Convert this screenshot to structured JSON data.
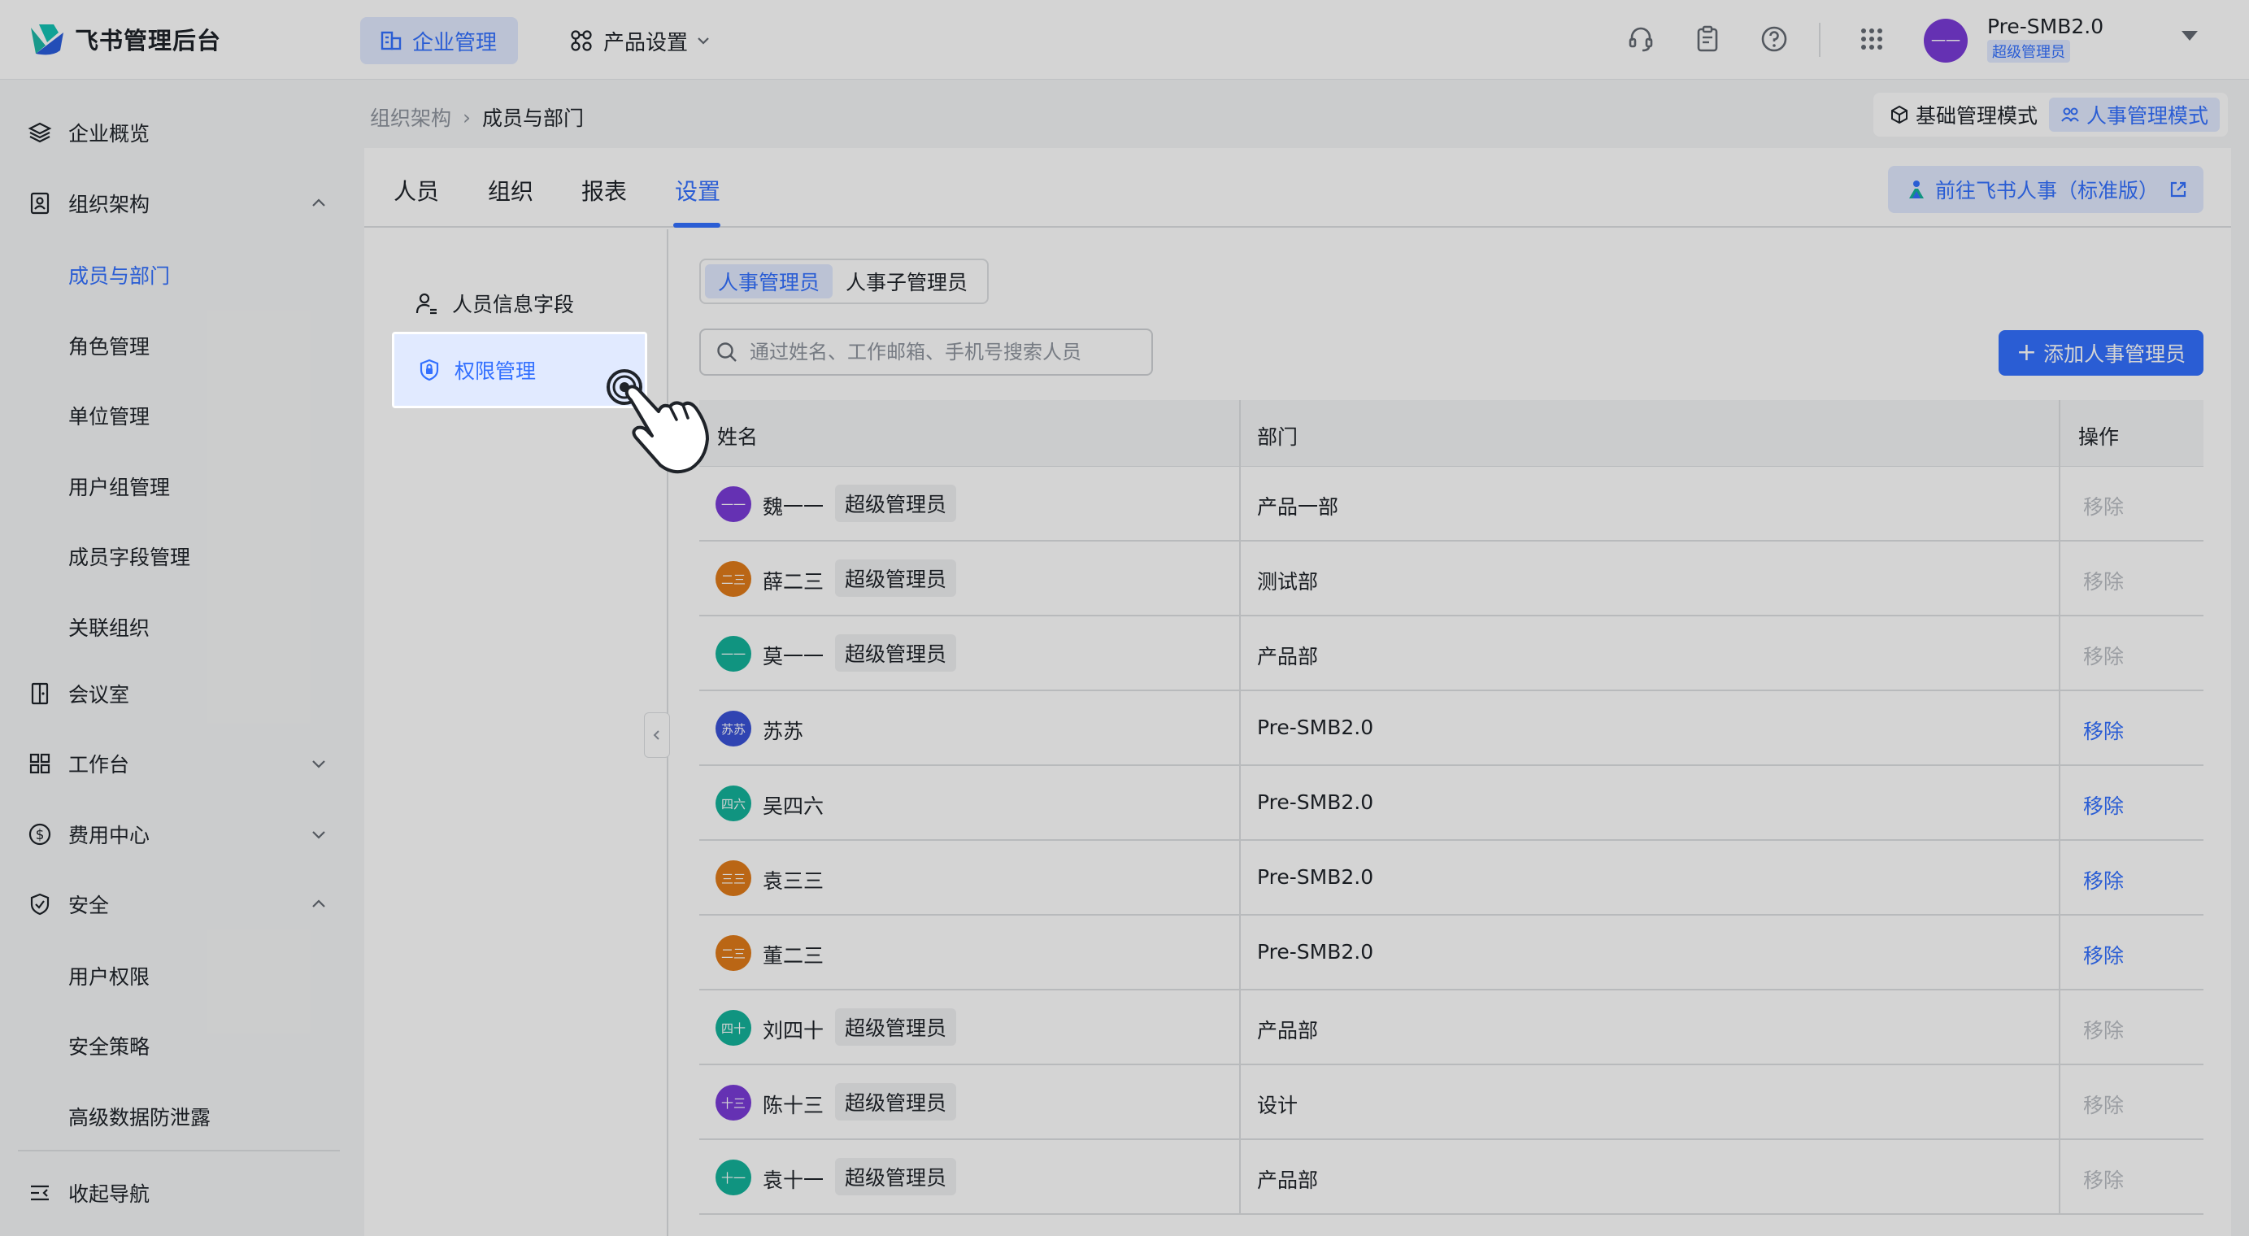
{
  "brand": {
    "name": "飞书管理后台"
  },
  "topnav": {
    "enterprise": "企业管理",
    "product": "产品设置"
  },
  "org": {
    "name": "Pre-SMB2.0",
    "role": "超级管理员",
    "avatar": "一一"
  },
  "sidebar": {
    "overview": "企业概览",
    "org": "组织架构",
    "org_sub": [
      "成员与部门",
      "角色管理",
      "单位管理",
      "用户组管理",
      "成员字段管理",
      "关联组织"
    ],
    "meeting": "会议室",
    "workbench": "工作台",
    "billing": "费用中心",
    "security": "安全",
    "security_sub": [
      "用户权限",
      "安全策略",
      "高级数据防泄露"
    ],
    "collapse": "收起导航"
  },
  "breadcrumb": {
    "parent": "组织架构",
    "current": "成员与部门"
  },
  "modes": {
    "basic": "基础管理模式",
    "hr": "人事管理模式"
  },
  "tabs": [
    "人员",
    "组织",
    "报表",
    "设置"
  ],
  "goto_button": "前往飞书人事（标准版）",
  "left_panel": {
    "fields": "人员信息字段",
    "permissions": "权限管理"
  },
  "segments": {
    "hr_admin": "人事管理员",
    "hr_sub_admin": "人事子管理员"
  },
  "search": {
    "placeholder": "通过姓名、工作邮箱、手机号搜索人员"
  },
  "add_button": "添加人事管理员",
  "table": {
    "headers": {
      "name": "姓名",
      "dept": "部门",
      "op": "操作"
    },
    "badge_label": "超级管理员",
    "remove_label": "移除",
    "rows": [
      {
        "name": "魏一一",
        "avatar": "一一",
        "color": "#7a3cd8",
        "super": true,
        "dept": "产品一部",
        "removable": false
      },
      {
        "name": "薛二三",
        "avatar": "二三",
        "color": "#e07b1a",
        "super": true,
        "dept": "测试部",
        "removable": false
      },
      {
        "name": "莫一一",
        "avatar": "一一",
        "color": "#14b39a",
        "super": true,
        "dept": "产品部",
        "removable": false
      },
      {
        "name": "苏苏",
        "avatar": "苏苏",
        "color": "#3a52d6",
        "super": false,
        "dept": "Pre-SMB2.0",
        "removable": true
      },
      {
        "name": "吴四六",
        "avatar": "四六",
        "color": "#14b39a",
        "super": false,
        "dept": "Pre-SMB2.0",
        "removable": true
      },
      {
        "name": "袁三三",
        "avatar": "三三",
        "color": "#e07b1a",
        "super": false,
        "dept": "Pre-SMB2.0",
        "removable": true
      },
      {
        "name": "董二三",
        "avatar": "二三",
        "color": "#e07b1a",
        "super": false,
        "dept": "Pre-SMB2.0",
        "removable": true
      },
      {
        "name": "刘四十",
        "avatar": "四十",
        "color": "#14b39a",
        "super": true,
        "dept": "产品部",
        "removable": false
      },
      {
        "name": "陈十三",
        "avatar": "十三",
        "color": "#7a3cd8",
        "super": true,
        "dept": "设计",
        "removable": false
      },
      {
        "name": "袁十一",
        "avatar": "十一",
        "color": "#14b39a",
        "super": true,
        "dept": "产品部",
        "removable": false
      }
    ]
  },
  "colors": {
    "accent": "#3370ff",
    "accent_bg": "#e1eaff",
    "disabled": "#bbbfc4"
  }
}
